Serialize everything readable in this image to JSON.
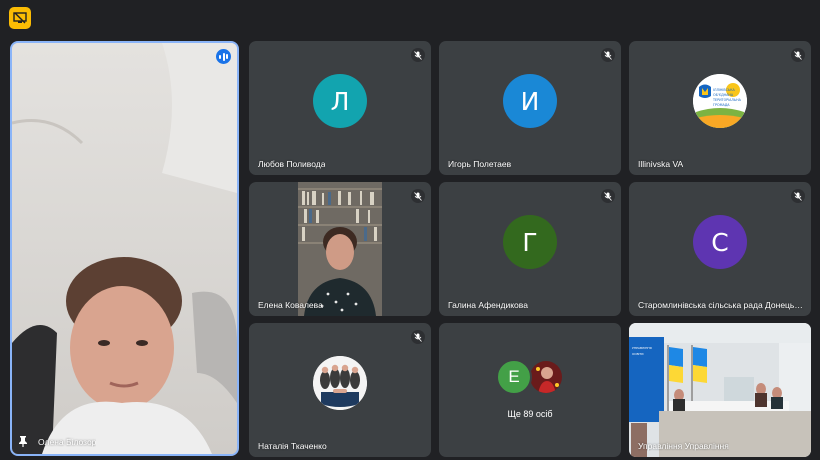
{
  "controls": {
    "icon": "present-screen-icon"
  },
  "main_participant": {
    "name": "Олена Білозор",
    "icon": "pin-icon"
  },
  "tiles": [
    {
      "name": "Любов Поливода",
      "initial": "Л",
      "color": "#12a4af"
    },
    {
      "name": "Игорь Полетаев",
      "initial": "И",
      "color": "#1a88d6"
    },
    {
      "name": "Illinivska VA",
      "logo_text": "ІЛЛІНІВСЬКА ОБ'ЄДНАНА ТЕРИТОРІАЛЬНА ГРОМАДА"
    },
    {
      "name": "Елена Ковалева"
    },
    {
      "name": "Галина Афендикова",
      "initial": "Г",
      "color": "#33691e"
    },
    {
      "name": "Старомлинівська сільська рада Донецької області",
      "initial": "С",
      "color": "#5e35b1"
    },
    {
      "name": "Наталія Ткаченко"
    },
    {
      "more_initial": "Е",
      "more_color": "#43a047",
      "label": "Ще 89 осіб"
    },
    {
      "name": "Управління Управління"
    }
  ],
  "mic_icon": "mic-off-icon"
}
